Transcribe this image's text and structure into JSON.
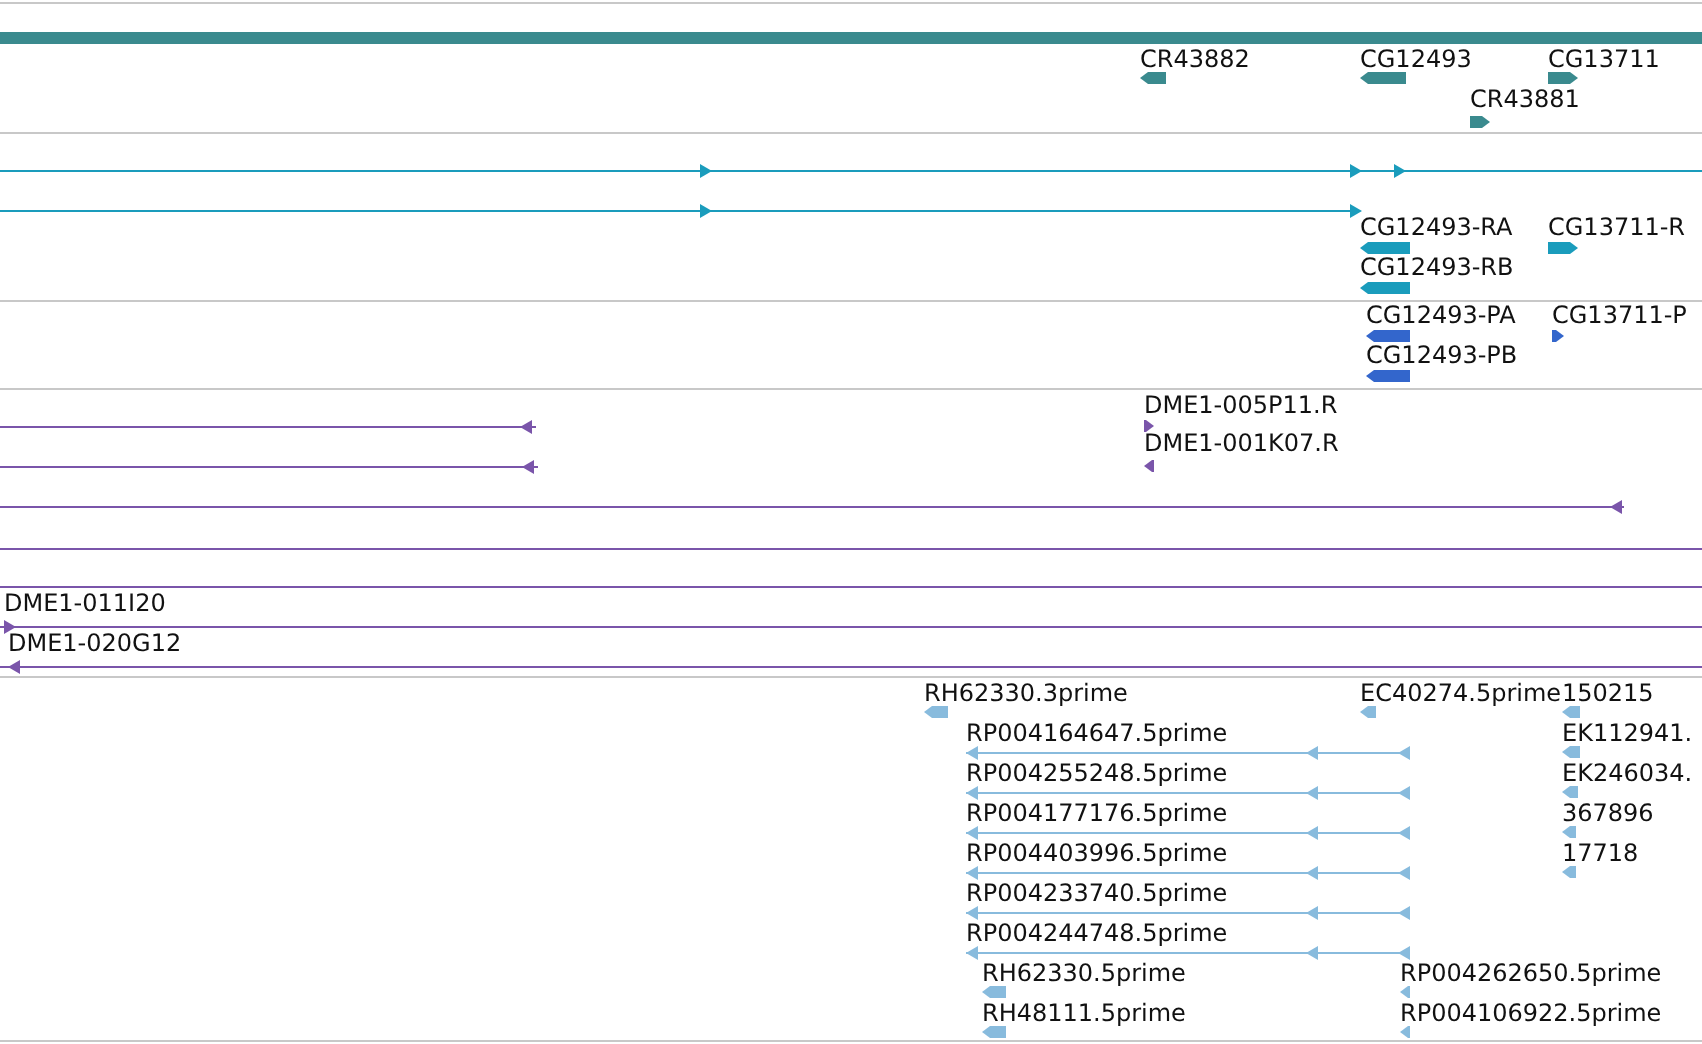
{
  "tracks": [
    {
      "color": "#3a8a8e",
      "features": [
        {
          "kind": "block",
          "label": "CR43882",
          "reverse": true
        },
        {
          "kind": "block",
          "label": "CG12493",
          "reverse": true
        },
        {
          "kind": "block",
          "label": "CG13711",
          "reverse": false
        },
        {
          "kind": "block",
          "label": "CR43881",
          "reverse": false
        }
      ]
    },
    {
      "color": "#1a9cbc",
      "features": [
        {
          "kind": "line",
          "reverse": false
        },
        {
          "kind": "line",
          "reverse": false
        },
        {
          "kind": "block",
          "label": "CG12493-RA",
          "reverse": true
        },
        {
          "kind": "block",
          "label": "CG12493-RB",
          "reverse": true
        },
        {
          "kind": "block",
          "label": "CG13711-R",
          "reverse": false
        }
      ]
    },
    {
      "color": "#3366cc",
      "features": [
        {
          "kind": "block",
          "label": "CG12493-PA",
          "reverse": true
        },
        {
          "kind": "block",
          "label": "CG12493-PB",
          "reverse": true
        },
        {
          "kind": "block",
          "label": "CG13711-P",
          "reverse": false
        }
      ]
    },
    {
      "color": "#7a55aa",
      "features": [
        {
          "kind": "line",
          "reverse": true
        },
        {
          "kind": "block",
          "label": "DME1-005P11.R",
          "reverse": false
        },
        {
          "kind": "line",
          "reverse": true
        },
        {
          "kind": "block",
          "label": "DME1-001K07.R",
          "reverse": true
        },
        {
          "kind": "line",
          "reverse": true
        },
        {
          "kind": "line"
        },
        {
          "kind": "line"
        },
        {
          "kind": "line",
          "label": "DME1-011I20",
          "reverse": false
        },
        {
          "kind": "line",
          "label": "DME1-020G12",
          "reverse": true
        }
      ]
    },
    {
      "color": "#88bbdd",
      "features": [
        {
          "kind": "block",
          "label": "RH62330.3prime",
          "reverse": true
        },
        {
          "kind": "block",
          "label": "EC40274.5prime",
          "reverse": true
        },
        {
          "kind": "block",
          "label": "150215",
          "reverse": true
        },
        {
          "kind": "line",
          "label": "RP004164647.5prime",
          "reverse": true
        },
        {
          "kind": "block",
          "label": "EK112941.",
          "reverse": true
        },
        {
          "kind": "line",
          "label": "RP004255248.5prime",
          "reverse": true
        },
        {
          "kind": "block",
          "label": "EK246034.",
          "reverse": true
        },
        {
          "kind": "line",
          "label": "RP004177176.5prime",
          "reverse": true
        },
        {
          "kind": "block",
          "label": "367896",
          "reverse": true
        },
        {
          "kind": "line",
          "label": "RP004403996.5prime",
          "reverse": true
        },
        {
          "kind": "block",
          "label": "17718",
          "reverse": true
        },
        {
          "kind": "line",
          "label": "RP004233740.5prime",
          "reverse": true
        },
        {
          "kind": "line",
          "label": "RP004244748.5prime",
          "reverse": true
        },
        {
          "kind": "block",
          "label": "RH62330.5prime",
          "reverse": true
        },
        {
          "kind": "block",
          "label": "RP004262650.5prime",
          "reverse": true
        },
        {
          "kind": "block",
          "label": "RH48111.5prime",
          "reverse": true
        },
        {
          "kind": "block",
          "label": "RP004106922.5prime",
          "reverse": true
        }
      ]
    }
  ]
}
